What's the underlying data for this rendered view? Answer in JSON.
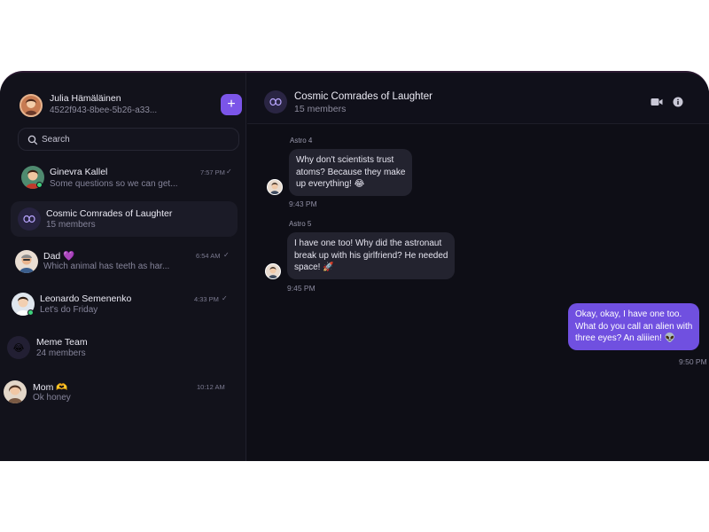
{
  "profile": {
    "name": "Julia Hämäläinen",
    "id": "4522f943-8bee-5b26-a33...",
    "new_label": "+"
  },
  "search": {
    "placeholder": "Search"
  },
  "conversations": [
    {
      "name": "Ginevra Kallel",
      "preview": "Some questions so we can get...",
      "time": "7:57 PM",
      "online": true
    },
    {
      "name": "Cosmic Comrades of Laughter",
      "preview": "15 members",
      "time": "",
      "active": true
    },
    {
      "name": "Dad 💜",
      "preview": "Which animal has teeth as har...",
      "time": "6:54 AM"
    },
    {
      "name": "Leonardo Semenenko",
      "preview": "Let's do Friday",
      "time": "4:33 PM",
      "online": true
    },
    {
      "name": "Meme Team",
      "preview": "24 members",
      "time": ""
    },
    {
      "name": "Mom 🫶",
      "preview": "Ok honey",
      "time": "10:12 AM"
    }
  ],
  "chat": {
    "title": "Cosmic Comrades of Laughter",
    "subtitle": "15 members",
    "messages": [
      {
        "sender": "Astro 4",
        "lines": [
          "Why don't scientists trust",
          "atoms? Because they make",
          "up everything! 😂"
        ],
        "time": "9:43 PM"
      },
      {
        "sender": "Astro 5",
        "lines": [
          "I have one too! Why did the astronaut",
          "break up with his girlfriend? He needed",
          "space! 🚀"
        ],
        "time": "9:45 PM"
      },
      {
        "sender": "",
        "lines": [
          "Okay, okay, I have one too.",
          "What do you call an alien with",
          "three eyes? An aliiien! 👽"
        ],
        "time": "9:50 PM",
        "mine": true
      }
    ]
  },
  "icons": {
    "video": "video-camera-icon",
    "info": "info-icon",
    "read": "✓"
  },
  "colors": {
    "accent": "#7b55e8",
    "background": "#0f0f17",
    "online": "#3ed07b"
  }
}
